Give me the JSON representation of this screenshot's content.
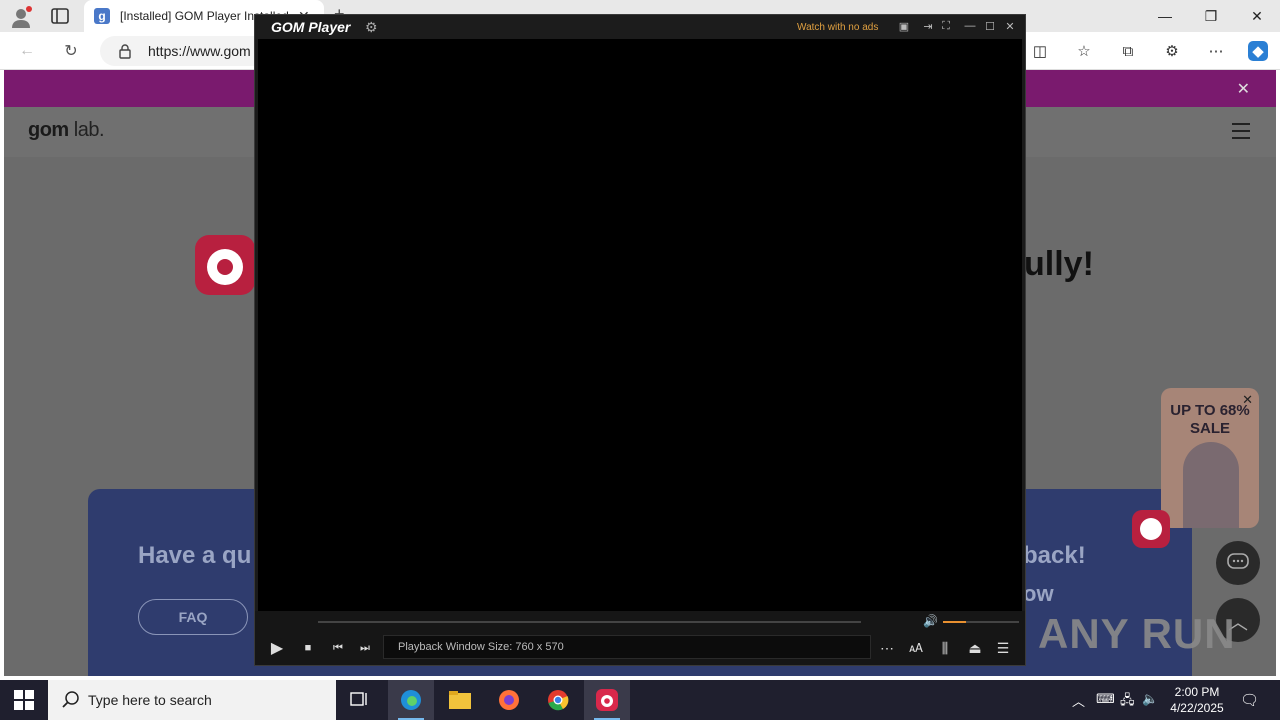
{
  "browser": {
    "tab_title": "[Installed] GOM Player Installed",
    "tab_favicon_letter": "g",
    "url": "https://www.gom",
    "new_tab_icon": "+",
    "close_tab_icon": "✕"
  },
  "site": {
    "logo_main": "gom",
    "logo_lab": "lab.",
    "success_partial": "ully!",
    "help_title": "Have a qu",
    "faq_label": "FAQ",
    "feedback_title": "back!",
    "feedback_sub": "ow",
    "sale_text": "UP TO 68% SALE",
    "watermark": "ANY RUN"
  },
  "player": {
    "logo": "GOM Player",
    "watch_no_ads": "Watch with no ads",
    "status": "Playback Window Size: 760 x 570",
    "volume_level": 0.3
  },
  "taskbar": {
    "search_placeholder": "Type here to search",
    "time": "2:00 PM",
    "date": "4/22/2025"
  },
  "colors": {
    "accent": "#b8203f",
    "volume": "#e89030"
  }
}
